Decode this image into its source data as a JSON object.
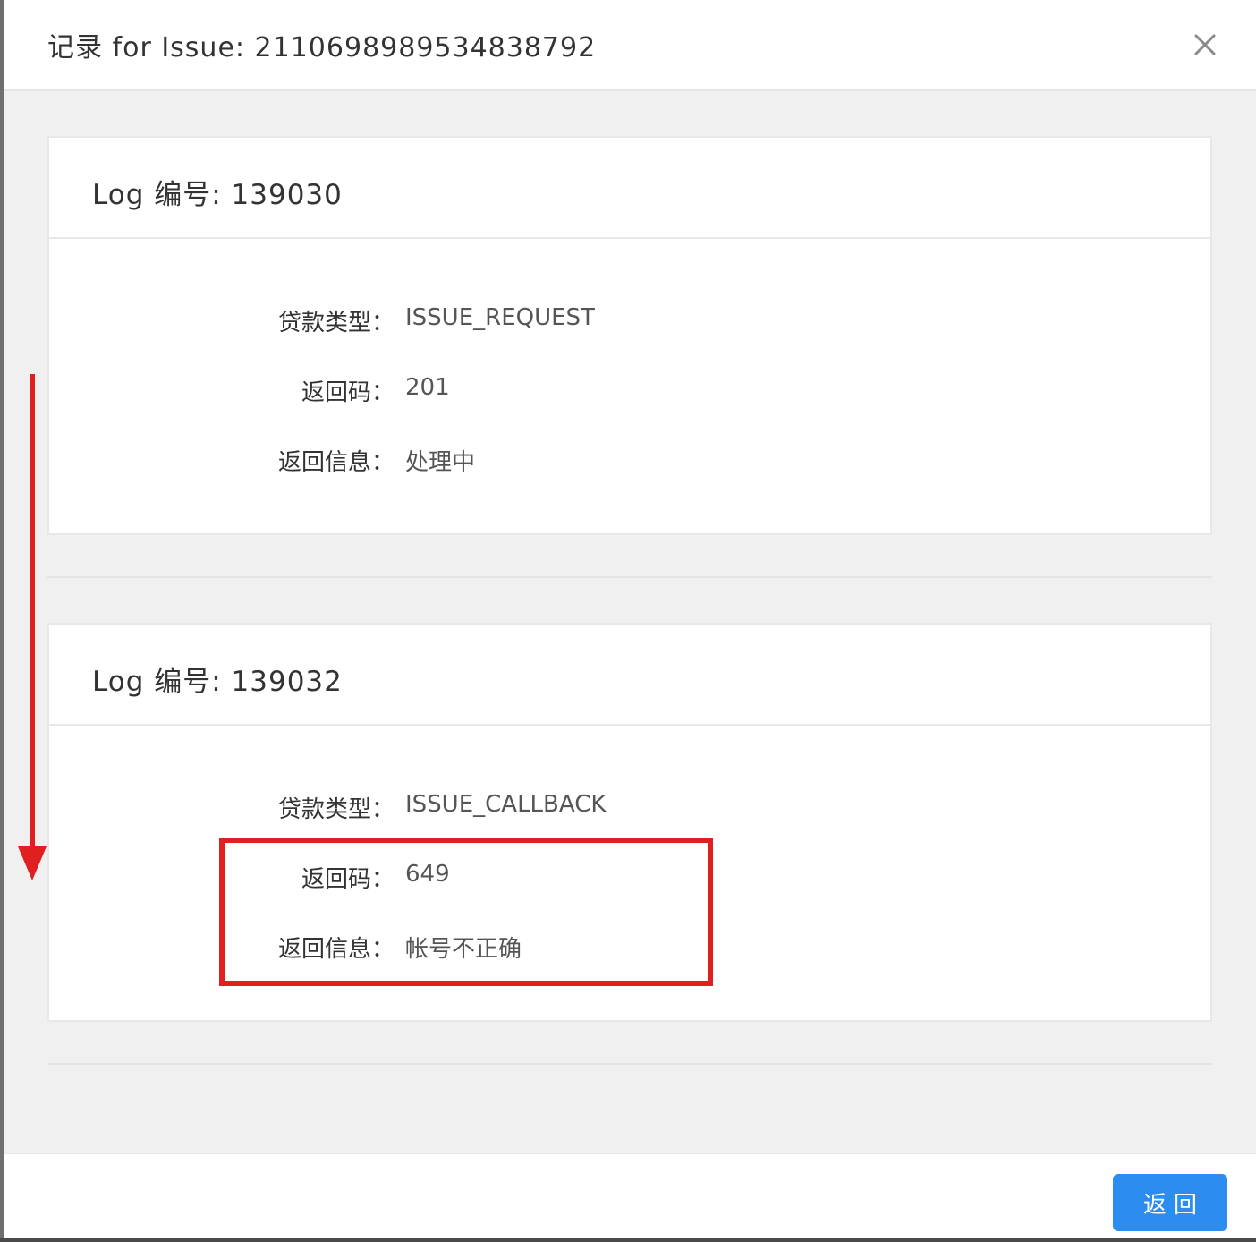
{
  "modal": {
    "title": "记录 for Issue: 2110698989534838792",
    "close_icon": "close-icon"
  },
  "logs": [
    {
      "title": "Log 编号: 139030",
      "fields": [
        {
          "label": "贷款类型：",
          "value": "ISSUE_REQUEST"
        },
        {
          "label": "返回码：",
          "value": "201"
        },
        {
          "label": "返回信息：",
          "value": "处理中"
        }
      ]
    },
    {
      "title": "Log 编号: 139032",
      "fields": [
        {
          "label": "贷款类型：",
          "value": "ISSUE_CALLBACK"
        },
        {
          "label": "返回码：",
          "value": "649"
        },
        {
          "label": "返回信息：",
          "value": "帐号不正确"
        }
      ]
    }
  ],
  "footer": {
    "back_label": "返回"
  },
  "colors": {
    "primary_button": "#2d8cf0",
    "annotation": "#e02020"
  }
}
